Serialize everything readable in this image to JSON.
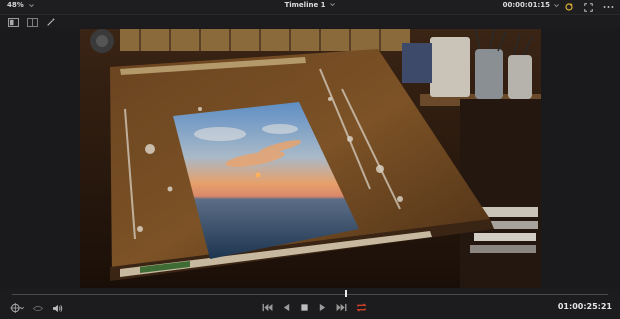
{
  "topbar": {
    "zoom_label": "48%",
    "timeline_title": "Timeline 1",
    "timecode": "00:00:01:15"
  },
  "transport": {
    "timecode": "01:00:25:21",
    "playhead_fraction": 0.56
  },
  "icons": {
    "zoom_dropdown": "chevron-down-icon",
    "timeline_dropdown": "chevron-down-icon",
    "timecode_dropdown": "chevron-down-icon",
    "playback_options": "swirl-icon",
    "fullscreen": "expand-icon",
    "more": "more-options-icon",
    "single_viewer": "single-viewer-icon",
    "dual_viewer": "dual-viewer-icon",
    "transform": "magic-wand-icon",
    "match_frame": "match-frame-icon",
    "audio_meter": "eye-icon",
    "volume": "speaker-icon",
    "first_frame": "skip-back-icon",
    "play_reverse": "play-reverse-icon",
    "stop": "stop-icon",
    "play": "play-icon",
    "last_frame": "skip-forward-icon",
    "loop": "loop-icon"
  },
  "colors": {
    "accent_loop": "#e0442a",
    "accent_swirl": "#e6b336"
  }
}
